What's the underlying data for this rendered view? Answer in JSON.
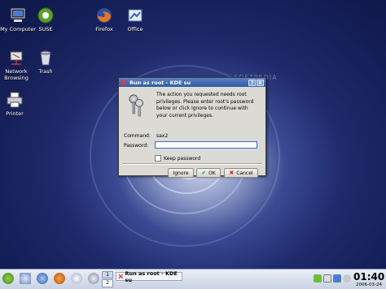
{
  "desktop": {
    "icons": [
      {
        "id": "my-computer",
        "label": "My Computer",
        "icon": "computer-icon"
      },
      {
        "id": "suse",
        "label": "SUSE",
        "icon": "suse-icon"
      },
      {
        "id": "firefox",
        "label": "Firefox",
        "icon": "firefox-icon"
      },
      {
        "id": "office",
        "label": "Office",
        "icon": "office-icon"
      },
      {
        "id": "network",
        "label": "Network Browsing",
        "icon": "network-icon"
      },
      {
        "id": "trash",
        "label": "Trash",
        "icon": "trash-icon"
      },
      {
        "id": "printer",
        "label": "Printer",
        "icon": "printer-icon"
      }
    ],
    "watermark": "SOFTPEDIA"
  },
  "dialog": {
    "title": "Run as root - KDE su",
    "message": "The action you requested needs root privileges. Please enter root's password below or click Ignore to continue with your current privileges.",
    "command_label": "Command:",
    "command_value": "sax2",
    "password_label": "Password:",
    "password_value": "",
    "keep_password_label": "Keep password",
    "keep_password_checked": false,
    "buttons": {
      "ignore": "Ignore",
      "ok": "OK",
      "cancel": "Cancel"
    },
    "titlebar_buttons": {
      "help": "?",
      "close": "X"
    }
  },
  "taskbar": {
    "desktop_pager": [
      "1",
      "2"
    ],
    "task_label": "Run as root - KDE su",
    "clock_time": "01:40",
    "clock_date": "2006-03-24",
    "colors": {
      "accent": "#2f5aa5",
      "focus": "#3a6ad0"
    }
  }
}
